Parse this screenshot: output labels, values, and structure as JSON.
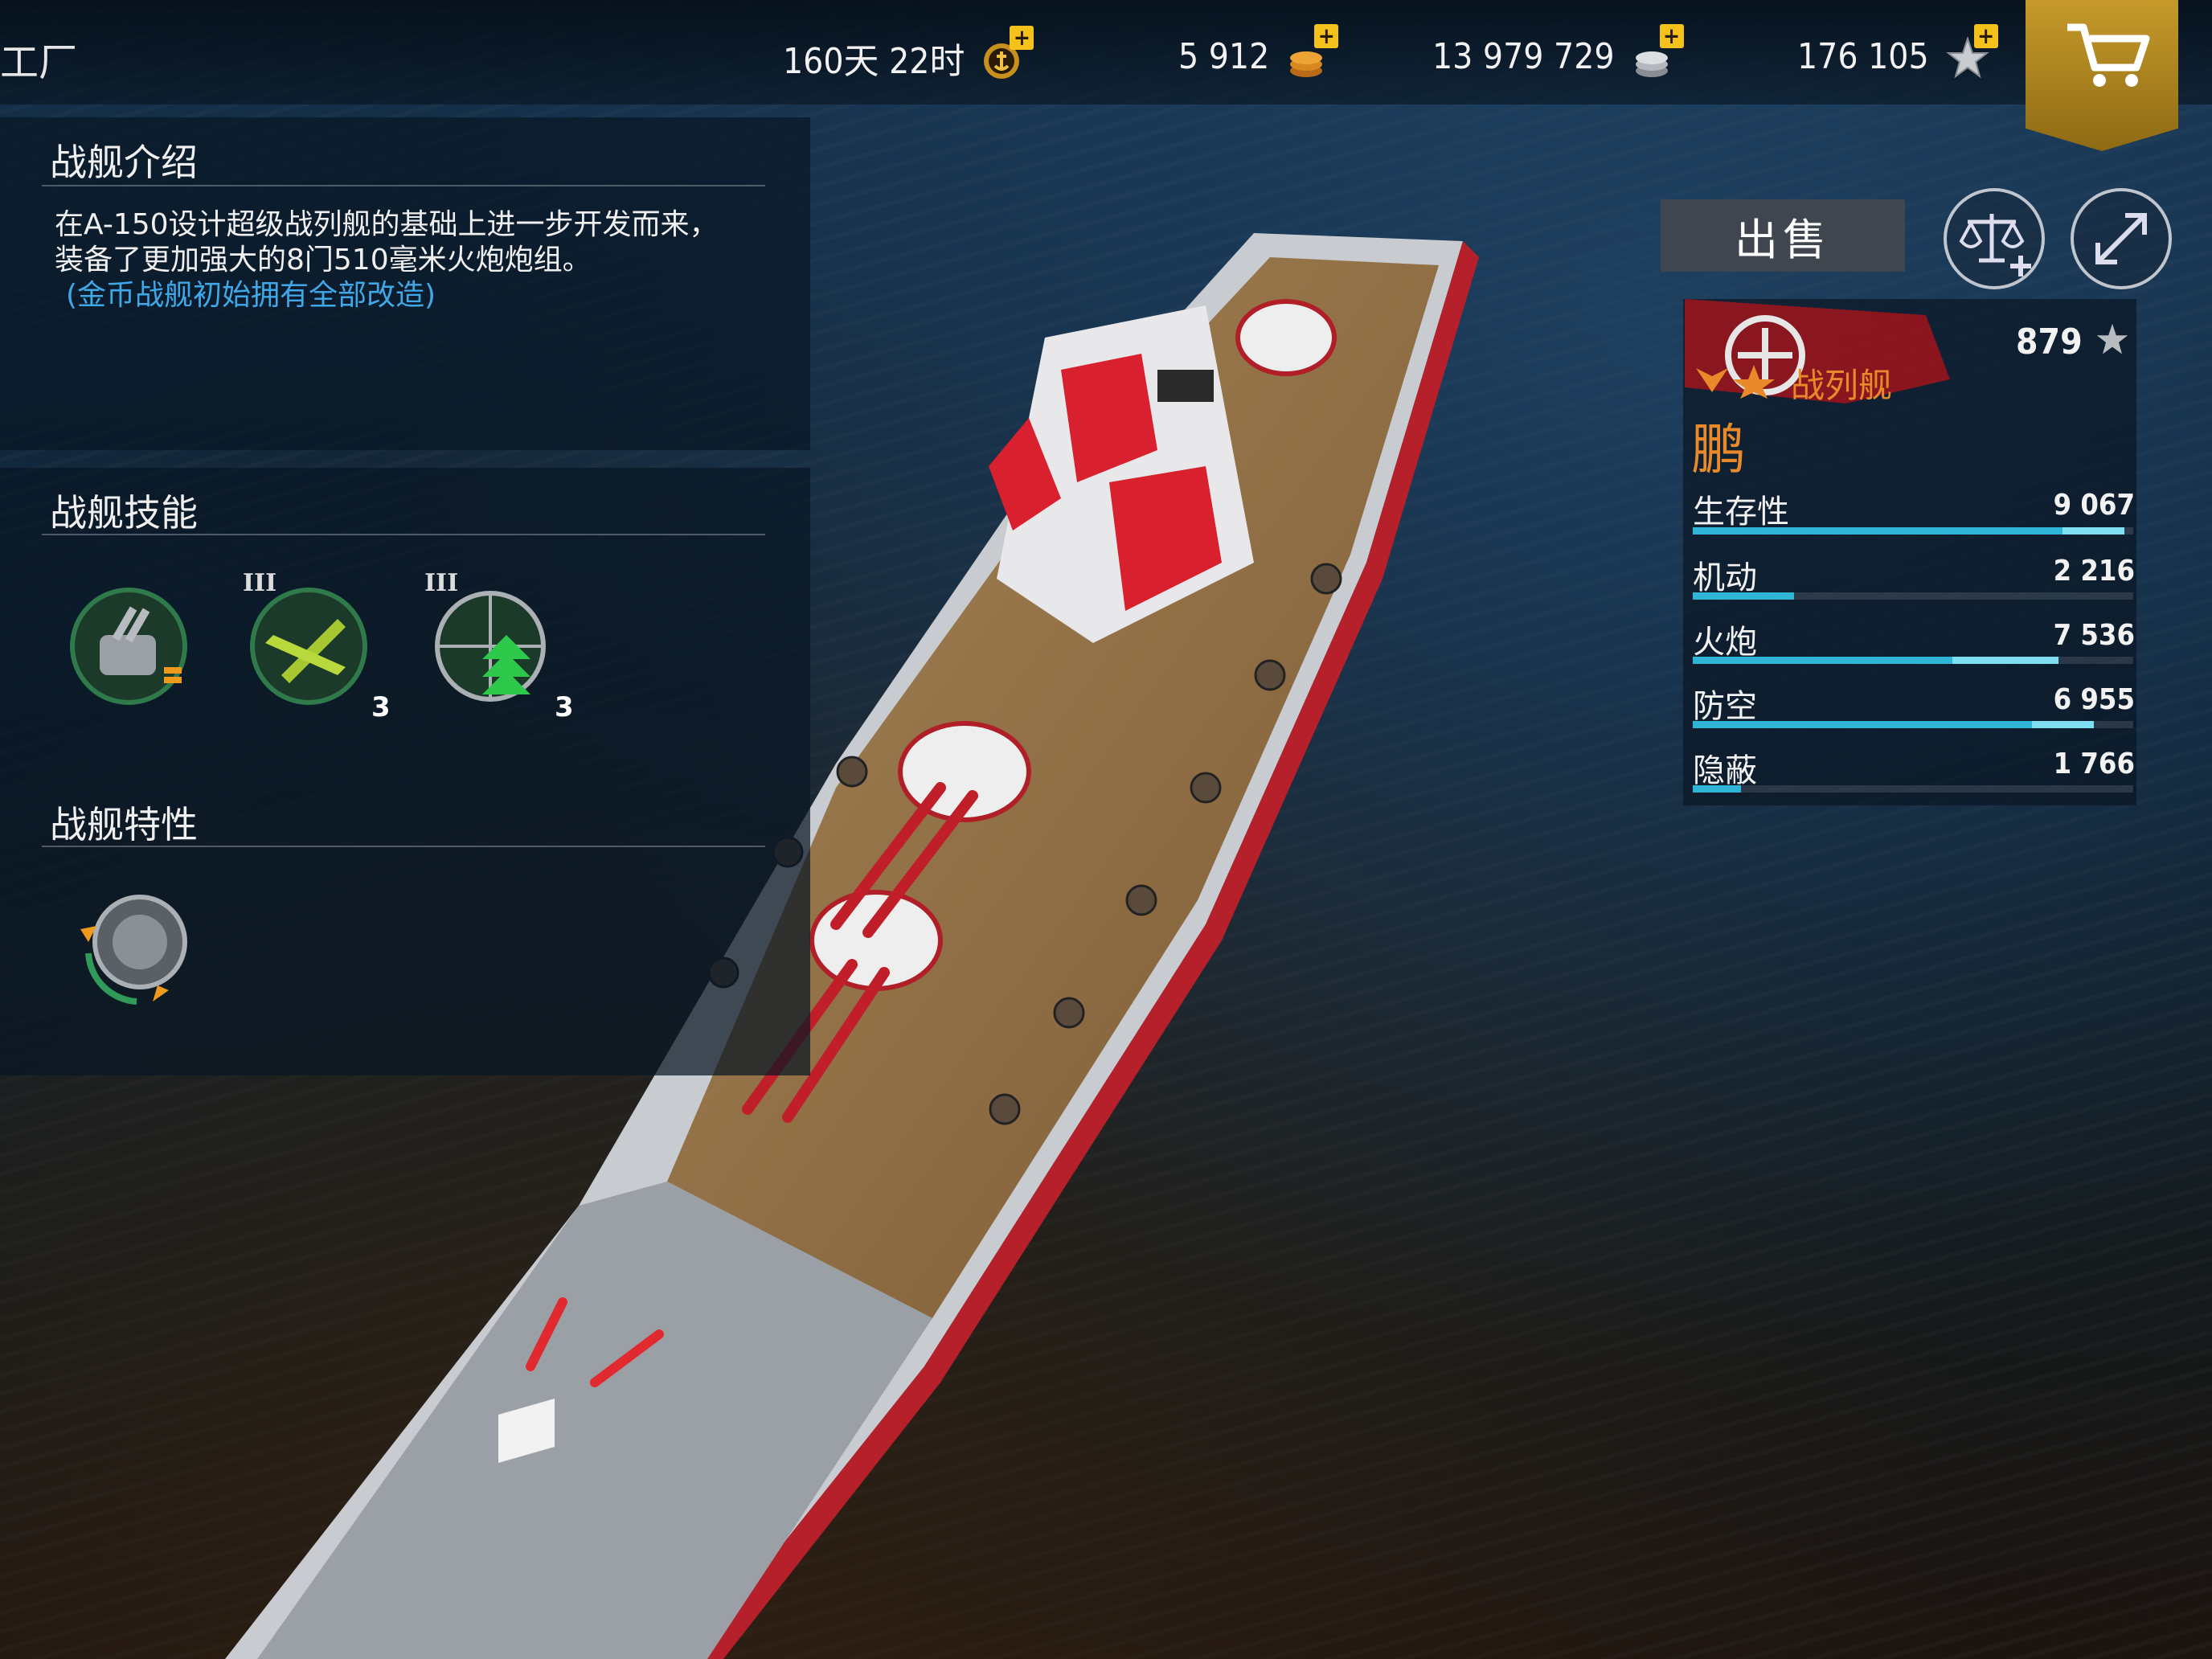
{
  "topbar": {
    "back_label": "工厂",
    "premium_time": "160天 22时",
    "gold": "5 912",
    "silver": "13 979 729",
    "stars": "176 105"
  },
  "intro": {
    "title": "战舰介绍",
    "line1": "在A-150设计超级战列舰的基础上进一步开发而来，",
    "line2": "装备了更加强大的8门510毫米火炮炮组。",
    "note": "(金币战舰初始拥有全部改造)"
  },
  "skills": {
    "title": "战舰技能",
    "items": [
      {
        "icon": "main-battery-skill-icon",
        "tier": "",
        "level": ""
      },
      {
        "icon": "fighter-plane-skill-icon",
        "tier": "III",
        "level": "3"
      },
      {
        "icon": "radar-boost-skill-icon",
        "tier": "III",
        "level": "3"
      }
    ]
  },
  "traits": {
    "title": "战舰特性",
    "items": [
      {
        "icon": "turret-reload-trait-icon"
      }
    ]
  },
  "actions": {
    "sell_label": "出售",
    "compare_icon": "scale-compare-icon",
    "expand_icon": "expand-icon"
  },
  "ship": {
    "rating": "879",
    "class": "战列舰",
    "name": "鹏",
    "colors": {
      "accent": "#e98a2a",
      "bar": "#2fb6d6",
      "bar_bonus": "#7fe0f4"
    }
  },
  "stats": [
    {
      "label": "生存性",
      "value": "9 067",
      "fill": 0.84,
      "bonus": 0.14
    },
    {
      "label": "机动",
      "value": "2 216",
      "fill": 0.23,
      "bonus": 0
    },
    {
      "label": "火炮",
      "value": "7 536",
      "fill": 0.59,
      "bonus": 0.24
    },
    {
      "label": "防空",
      "value": "6 955",
      "fill": 0.77,
      "bonus": 0.14
    },
    {
      "label": "隐蔽",
      "value": "1 766",
      "fill": 0.11,
      "bonus": 0
    }
  ]
}
